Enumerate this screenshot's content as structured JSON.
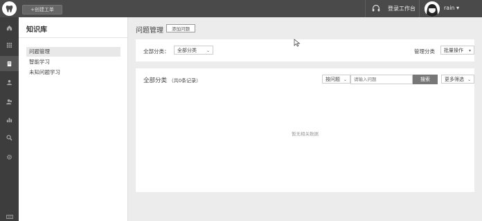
{
  "topbar": {
    "new_order_label": "+创建工单",
    "login_workspace": "登录工作台",
    "username": "rain ▾"
  },
  "rail": {
    "icons": [
      "home-icon",
      "grid-icon",
      "book-icon",
      "user-icon",
      "users-icon",
      "chart-icon",
      "search-icon",
      "gear-icon",
      "keyboard-icon"
    ],
    "active_index": 2
  },
  "subnav": {
    "title": "知识库",
    "items": [
      {
        "label": "问题管理",
        "active": true
      },
      {
        "label": "智能学习",
        "active": false
      },
      {
        "label": "未知问题学习",
        "active": false
      }
    ]
  },
  "main": {
    "page_title": "问题管理",
    "add_question_label": "添加问题",
    "filter": {
      "category_label": "全部分类：",
      "category_value": "全部分类",
      "manage_category_label": "管理分类",
      "batch_action_label": "批量操作"
    },
    "list": {
      "title": "全部分类",
      "count_text": "（共0条记录）",
      "search_by_value": "按问题",
      "search_placeholder": "请输入问题",
      "search_button": "搜索",
      "more_filter_label": "更多筛选",
      "empty_text": "暂无相关数据"
    }
  }
}
